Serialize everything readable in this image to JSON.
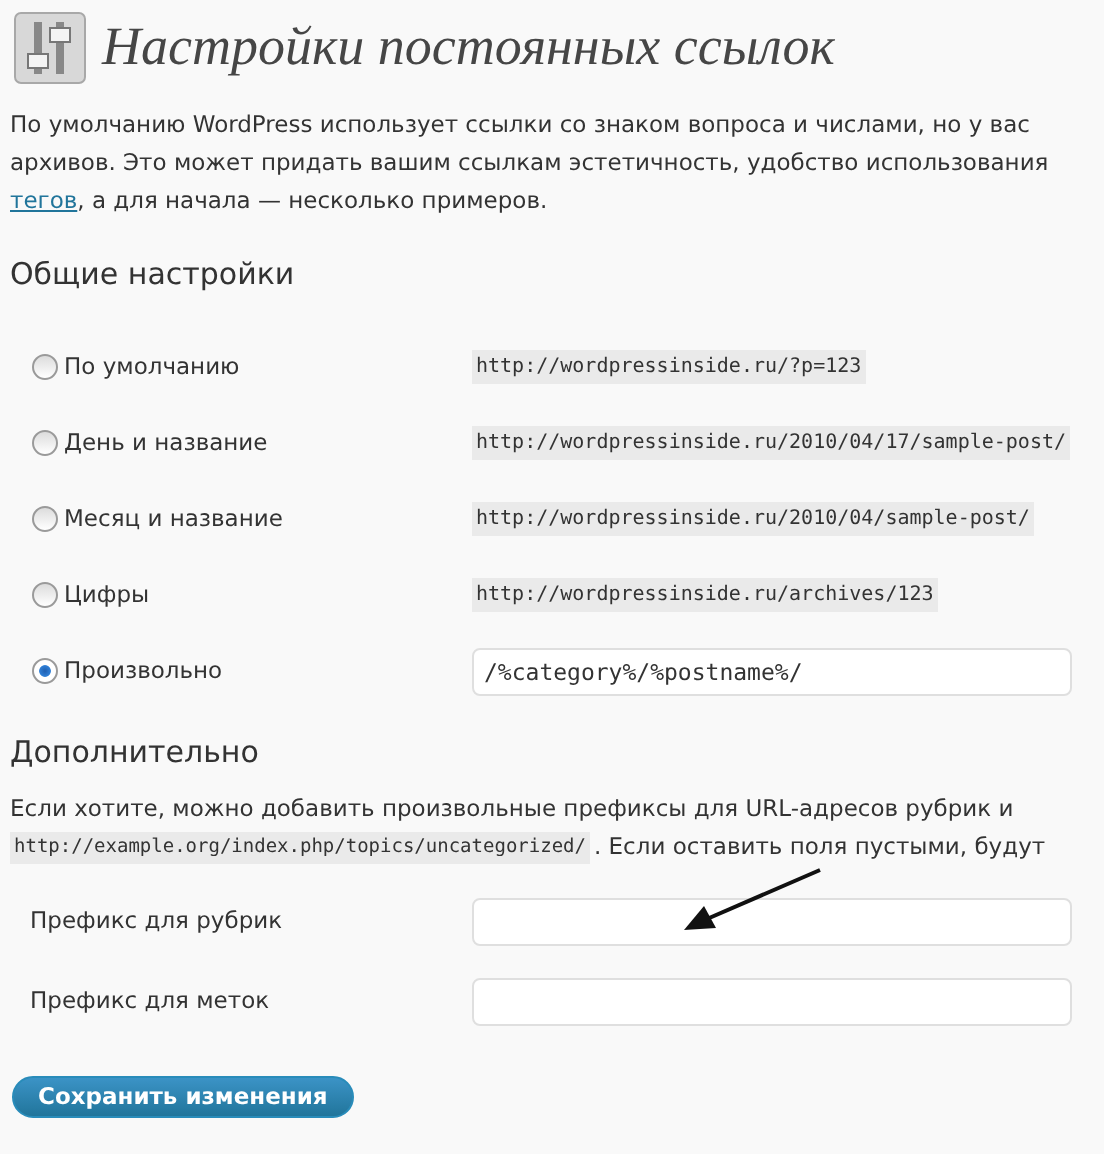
{
  "page": {
    "title": "Настройки постоянных ссылок"
  },
  "intro": {
    "lines": [
      "По умолчанию WordPress использует ссылки со знаком вопроса и числами, но у вас",
      "архивов. Это может придать вашим ссылкам эстетичность, удобство использования"
    ],
    "link": "тегов",
    "tail": ", а для начала — несколько примеров."
  },
  "general": {
    "heading": "Общие настройки",
    "options": [
      {
        "label": "По умолчанию",
        "selected": false,
        "kind": "example",
        "example": "http://wordpressinside.ru/?p=123"
      },
      {
        "label": "День и название",
        "selected": false,
        "kind": "example",
        "example": "http://wordpressinside.ru/2010/04/17/sample-post/"
      },
      {
        "label": "Месяц и название",
        "selected": false,
        "kind": "example",
        "example": "http://wordpressinside.ru/2010/04/sample-post/"
      },
      {
        "label": "Цифры",
        "selected": false,
        "kind": "example",
        "example": "http://wordpressinside.ru/archives/123"
      },
      {
        "label": "Произвольно",
        "selected": true,
        "kind": "input",
        "value": "/%category%/%postname%/"
      }
    ]
  },
  "optional": {
    "heading": "Дополнительно",
    "line1": "Если хотите, можно добавить произвольные префиксы для URL-адресов рубрик и",
    "code": "http://example.org/index.php/topics/uncategorized/",
    "line2": ". Если оставить поля пустыми, будут",
    "fields": [
      {
        "label": "Префикс для рубрик"
      },
      {
        "label": "Префикс для меток"
      }
    ]
  },
  "save_button": "Сохранить изменения"
}
